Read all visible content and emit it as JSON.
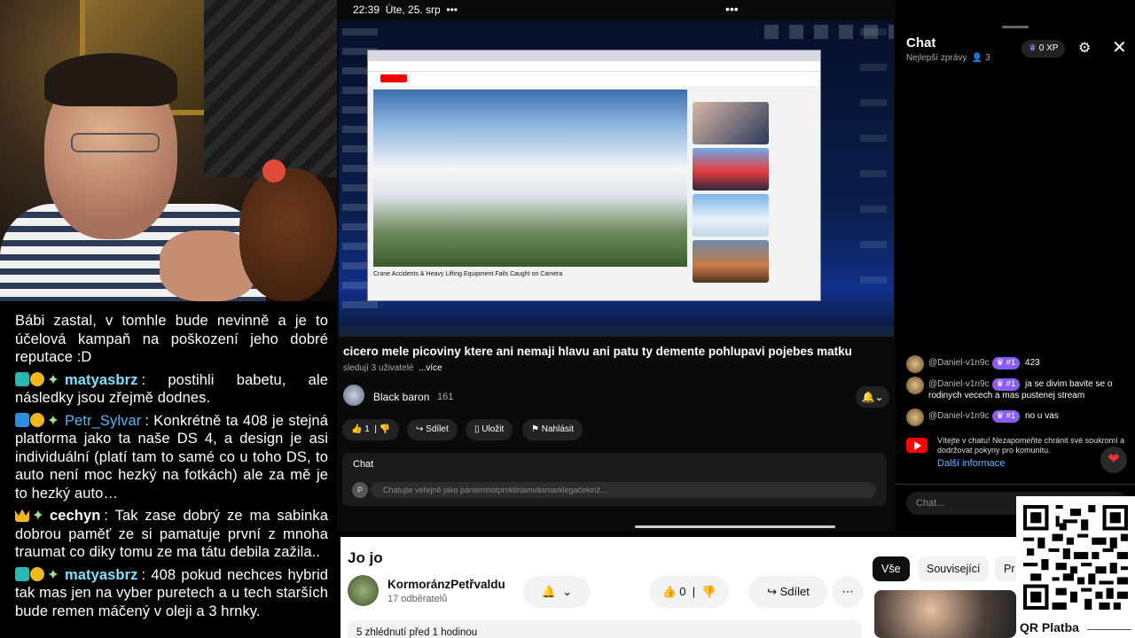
{
  "statusbar": {
    "time": "22:39",
    "date": "Úte, 25. srp",
    "more": "•••",
    "center_dots": "•••",
    "battery": "16"
  },
  "left_chat": {
    "messages": [
      {
        "badges": [],
        "user": "",
        "text": "Bábi zastal, v tomhle bude nevinně a je to účelová kampaň na poškození jeho dobré reputace :D"
      },
      {
        "badges": [
          "teal",
          "gold"
        ],
        "user": "matyasbrz",
        "text": "postihli babetu, ale následky jsou zřejmě dodnes."
      },
      {
        "badges": [
          "blue",
          "gold"
        ],
        "user": "Petr_Sylvar",
        "text": "Konkrétně ta 408 je stejná platforma jako ta naše DS 4, a design je asi individuální (platí tam to samé co u toho DS, to auto není moc hezký na fotkách) ale za mě je to hezký auto…"
      },
      {
        "badges": [
          "crown"
        ],
        "user": "cechyn",
        "text": "Tak zase dobrý ze ma sabinka dobrou paměť ze si pamatuje první z mnoha traumat co diky tomu ze ma tátu debila zažila.."
      },
      {
        "badges": [
          "teal",
          "gold"
        ],
        "user": "matyasbrz",
        "text": "408 pokud nechces hybrid tak mas jen na vyber puretech a u tech starších bude remen máčený v oleji a 3 hrnky."
      }
    ]
  },
  "mobile": {
    "inner_video_title": "Crane Accidents & Heavy Lifting Equipment Fails Caught on Camera",
    "stream_title": "cicero mele picoviny ktere ani nemaji hlavu ani patu ty demente pohlupavi pojebes matku",
    "watching": "sledují 3 uživatelé",
    "more": "...více",
    "channel_name": "Black baron",
    "channel_count": "161",
    "bell": "🔔⌄",
    "like_count": "1",
    "share": "Sdílet",
    "save": "Uložit",
    "report": "Nahlásit",
    "chat_label": "Chat",
    "chat_avatar": "P",
    "chat_placeholder": "Chatujte veřejně jako pántemnotproklinamvásmarklegačekinž..."
  },
  "live_chat": {
    "title": "Chat",
    "subtitle": "Nejlepší zprávy",
    "viewers": "3",
    "xp": "0 XP",
    "messages": [
      {
        "user": "@Daniel-v1n9c",
        "rank": "#1",
        "text": "423"
      },
      {
        "user": "@Daniel-v1n9c",
        "rank": "#1",
        "text": "ja se divim bavite se o rodinych vecech a mas pustenej stream"
      },
      {
        "user": "@Daniel-v1n9c",
        "rank": "#1",
        "text": "no u vas"
      }
    ],
    "welcome": "Vítejte v chatu! Nezapomeňte chránit své soukromí a dodržovat pokyny pro komunitu.",
    "more_info": "Další informace",
    "input_placeholder": "Chat..."
  },
  "yt_bottom": {
    "title": "Jo jo",
    "channel": "KormoránzPetřvaldu",
    "subscribers": "17 odběratelů",
    "likes": "0",
    "share": "Sdílet",
    "views": "5 zhlédnutí  před 1 hodinou",
    "chips": [
      "Vše",
      "Související",
      "Pr"
    ]
  },
  "qr": {
    "label": "QR Platba"
  }
}
